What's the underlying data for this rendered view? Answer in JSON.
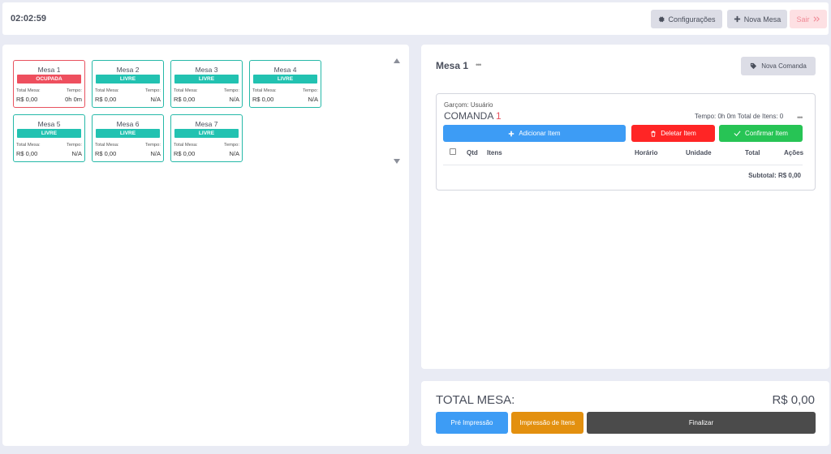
{
  "header": {
    "clock": "02:02:59",
    "config_label": "Configurações",
    "nova_mesa_label": "Nova Mesa",
    "sair_label": "Sair"
  },
  "mesas": [
    {
      "name": "Mesa 1",
      "status": "OCUPADA",
      "total_label": "Total Mesa:",
      "tempo_label": "Tempo:",
      "total": "R$ 0,00",
      "tempo": "0h 0m"
    },
    {
      "name": "Mesa 2",
      "status": "LIVRE",
      "total_label": "Total Mesa:",
      "tempo_label": "Tempo:",
      "total": "R$ 0,00",
      "tempo": "N/A"
    },
    {
      "name": "Mesa 3",
      "status": "LIVRE",
      "total_label": "Total Mesa:",
      "tempo_label": "Tempo:",
      "total": "R$ 0,00",
      "tempo": "N/A"
    },
    {
      "name": "Mesa 4",
      "status": "LIVRE",
      "total_label": "Total Mesa:",
      "tempo_label": "Tempo:",
      "total": "R$ 0,00",
      "tempo": "N/A"
    },
    {
      "name": "Mesa 5",
      "status": "LIVRE",
      "total_label": "Total Mesa:",
      "tempo_label": "Tempo:",
      "total": "R$ 0,00",
      "tempo": "N/A"
    },
    {
      "name": "Mesa 6",
      "status": "LIVRE",
      "total_label": "Total Mesa:",
      "tempo_label": "Tempo:",
      "total": "R$ 0,00",
      "tempo": "N/A"
    },
    {
      "name": "Mesa 7",
      "status": "LIVRE",
      "total_label": "Total Mesa:",
      "tempo_label": "Tempo:",
      "total": "R$ 0,00",
      "tempo": "N/A"
    }
  ],
  "detail": {
    "mesa_title": "Mesa 1",
    "menu_dots": "•••",
    "nova_comanda_label": "Nova Comanda",
    "comanda": {
      "garcom": "Garçom: Usuário",
      "title": "COMANDA",
      "number": "1",
      "tempo_info": "Tempo: 0h 0m  Total de Itens: 0",
      "menu_dots": "•••",
      "add_label": "Adicionar Item",
      "delete_label": "Deletar Item",
      "confirm_label": "Confirmar Item",
      "columns": [
        "Qtd",
        "Itens",
        "Horário",
        "Unidade",
        "Total",
        "Ações"
      ],
      "subtotal": "Subtotal: R$ 0,00"
    }
  },
  "footer": {
    "total_label": "TOTAL MESA:",
    "total_value": "R$ 0,00",
    "pre_label": "Pré Impressão",
    "imp_label": "Impressão de Itens",
    "fin_label": "Finalizar"
  },
  "colors": {
    "livre": "#22c2b1",
    "ocupada": "#ee4f5e",
    "primary": "#3d9cf5",
    "danger": "#ff2525",
    "success": "#27c455",
    "warning": "#e3900f",
    "dark": "#4b4b4b"
  }
}
